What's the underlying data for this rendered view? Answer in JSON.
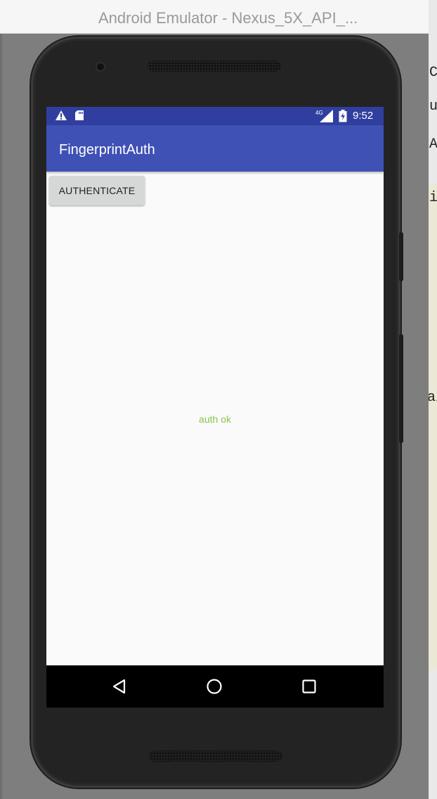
{
  "window": {
    "title": "Android Emulator - Nexus_5X_API_..."
  },
  "background_glyphs": [
    "C",
    "u",
    "A",
    "i",
    "a/"
  ],
  "statusbar": {
    "icons": [
      "warning-icon",
      "sd-card-icon",
      "signal-4g-icon",
      "battery-charging-icon"
    ],
    "network_label": "4G",
    "time": "9:52",
    "color": "#303f9f"
  },
  "app": {
    "title": "FingerprintAuth",
    "appbar_color": "#3f51b5",
    "button_label": "AUTHENTICATE",
    "status_text": "auth ok",
    "status_color": "#8bc34a",
    "background_color": "#fafafa"
  },
  "navbar": {
    "icons": [
      "back-icon",
      "home-icon",
      "recents-icon"
    ]
  }
}
